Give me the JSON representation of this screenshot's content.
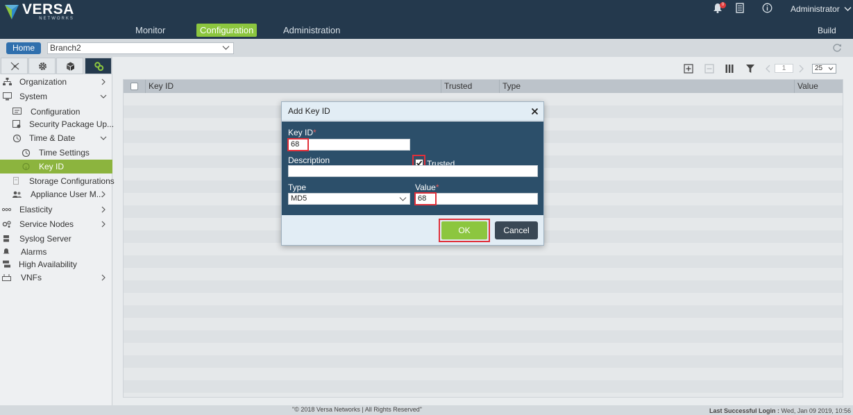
{
  "header": {
    "brand": "VERSA",
    "brand_sub": "NETWORKS",
    "nav": [
      "Monitor",
      "Configuration",
      "Administration"
    ],
    "active_nav": "Configuration",
    "notification_count": "0",
    "user": "Administrator",
    "build_label": "Build",
    "accent_color": "#8cc63f",
    "bar_color": "#24394d"
  },
  "subbar": {
    "home_label": "Home",
    "appliance": "Branch2"
  },
  "sidebar": {
    "tabs": [
      "network-icon",
      "gear-icon",
      "cube-icon",
      "services-icon"
    ],
    "items": [
      {
        "label": "Organization",
        "icon": "org-icon"
      },
      {
        "label": "System",
        "icon": "system-icon"
      },
      {
        "label": "Configuration",
        "icon": "config-icon"
      },
      {
        "label": "Security Package Up...",
        "icon": "package-icon"
      },
      {
        "label": "Time & Date",
        "icon": "clock-icon"
      },
      {
        "label": "Time Settings",
        "icon": "time-settings-icon"
      },
      {
        "label": "Key ID",
        "icon": "key-icon"
      },
      {
        "label": "Storage Configurations",
        "icon": "storage-icon"
      },
      {
        "label": "Appliance User M...",
        "icon": "users-icon"
      },
      {
        "label": "Elasticity",
        "icon": "elasticity-icon"
      },
      {
        "label": "Service Nodes",
        "icon": "service-nodes-icon"
      },
      {
        "label": "Syslog Server",
        "icon": "syslog-icon"
      },
      {
        "label": "Alarms",
        "icon": "alarm-icon"
      },
      {
        "label": "High Availability",
        "icon": "ha-icon"
      },
      {
        "label": "VNFs",
        "icon": "vnf-icon"
      }
    ],
    "selected": "Key ID"
  },
  "table": {
    "columns": [
      "Key ID",
      "Trusted",
      "Type",
      "Value"
    ],
    "page": "1",
    "per_page": "25"
  },
  "modal": {
    "title": "Add Key ID",
    "key_id_label": "Key ID",
    "key_id_value": "68",
    "trusted_label": "Trusted",
    "trusted_checked": true,
    "description_label": "Description",
    "description_value": "",
    "type_label": "Type",
    "type_value": "MD5",
    "value_label": "Value",
    "value_value": "68",
    "ok_label": "OK",
    "cancel_label": "Cancel",
    "required_mark": "*"
  },
  "footer": {
    "copyright": "\"© 2018 Versa Networks | All Rights Reserved\"",
    "last_login_label": "Last Successful Login :",
    "last_login_value": "Wed, Jan 09 2019, 10:56"
  }
}
